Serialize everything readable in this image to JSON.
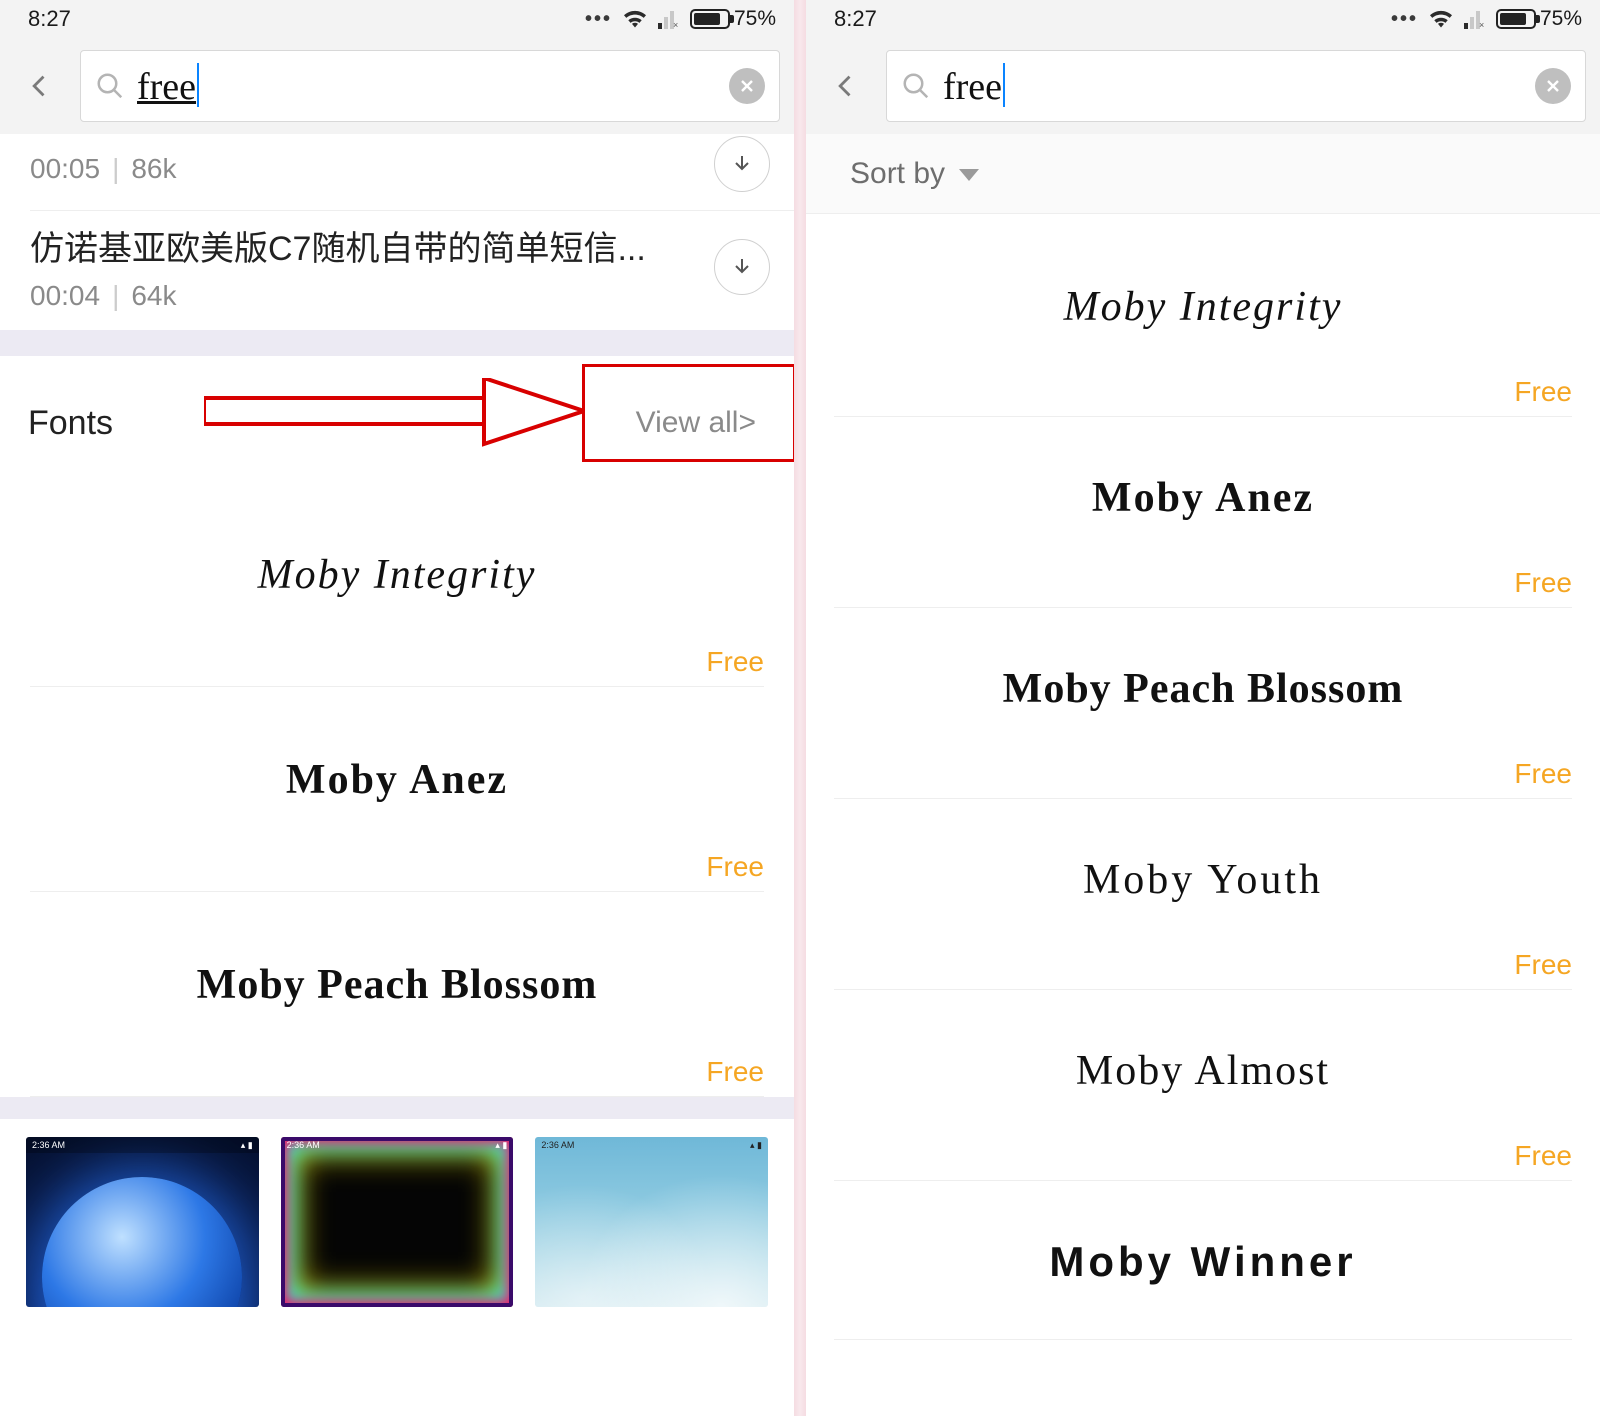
{
  "status": {
    "time": "8:27",
    "battery_pct": "75%"
  },
  "search": {
    "query": "free"
  },
  "left": {
    "ringtones": [
      {
        "title_partial": "",
        "duration": "00:05",
        "size": "86k"
      },
      {
        "title": "仿诺基亚欧美版C7随机自带的简单短信...",
        "duration": "00:04",
        "size": "64k"
      }
    ],
    "fonts_header": {
      "label": "Fonts",
      "view_all": "View all>"
    },
    "fonts": [
      {
        "name": "Moby Integrity",
        "price": "Free",
        "style": "style-integrity"
      },
      {
        "name": "Moby Anez",
        "price": "Free",
        "style": "style-anez"
      },
      {
        "name": "Moby Peach Blossom",
        "price": "Free",
        "style": "style-peach"
      }
    ],
    "thumb_time": "2:36 AM"
  },
  "right": {
    "sort_by": "Sort by",
    "fonts": [
      {
        "name": "Moby Integrity",
        "price": "Free",
        "style": "style-integrity"
      },
      {
        "name": "Moby Anez",
        "price": "Free",
        "style": "style-anez"
      },
      {
        "name": "Moby Peach Blossom",
        "price": "Free",
        "style": "style-peach"
      },
      {
        "name": "Moby Youth",
        "price": "Free",
        "style": "style-youth"
      },
      {
        "name": "Moby Almost",
        "price": "Free",
        "style": "style-almost"
      },
      {
        "name": "Moby Winner",
        "price": "",
        "style": "style-winner"
      }
    ]
  }
}
